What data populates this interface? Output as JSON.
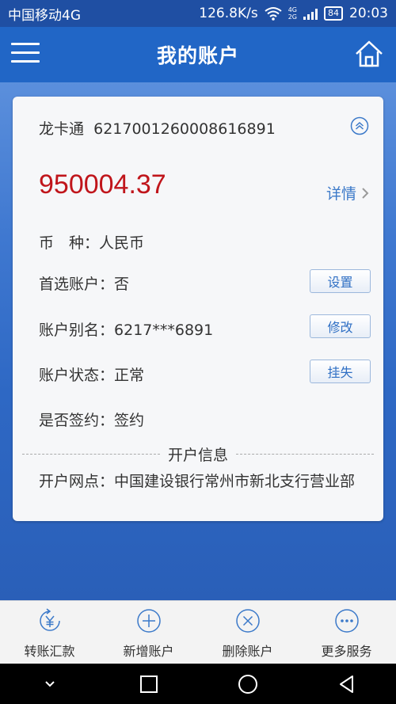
{
  "status_bar": {
    "carrier": "中国移动4G",
    "speed": "126.8K/s",
    "net_top": "4G",
    "net_bottom": "2G",
    "battery": "84",
    "time": "20:03"
  },
  "header": {
    "title": "我的账户"
  },
  "card": {
    "card_type": "龙卡通",
    "card_number": "6217001260008616891",
    "balance": "950004.37",
    "detail_label": "详情",
    "currency_label": "币　种：",
    "currency_value": "人民币",
    "preferred_label": "首选账户：",
    "preferred_value": "否",
    "set_button": "设置",
    "alias_label": "账户别名：",
    "alias_value": "6217***6891",
    "modify_button": "修改",
    "status_label": "账户状态：",
    "status_value": "正常",
    "report_loss_button": "挂失",
    "signed_label": "是否签约：",
    "signed_value": "签约",
    "opening_info_title": "开户信息",
    "branch_label": "开户网点：",
    "branch_value": "中国建设银行常州市新北支行营业部"
  },
  "actions": [
    {
      "label": "转账汇款",
      "icon": "yen-transfer-icon"
    },
    {
      "label": "新增账户",
      "icon": "plus-circle-icon"
    },
    {
      "label": "删除账户",
      "icon": "x-circle-icon"
    },
    {
      "label": "更多服务",
      "icon": "more-circle-icon"
    }
  ],
  "colors": {
    "header_bg": "#2166c6",
    "balance": "#c0151b",
    "link": "#3b79c9",
    "icon": "#3b79c9"
  }
}
